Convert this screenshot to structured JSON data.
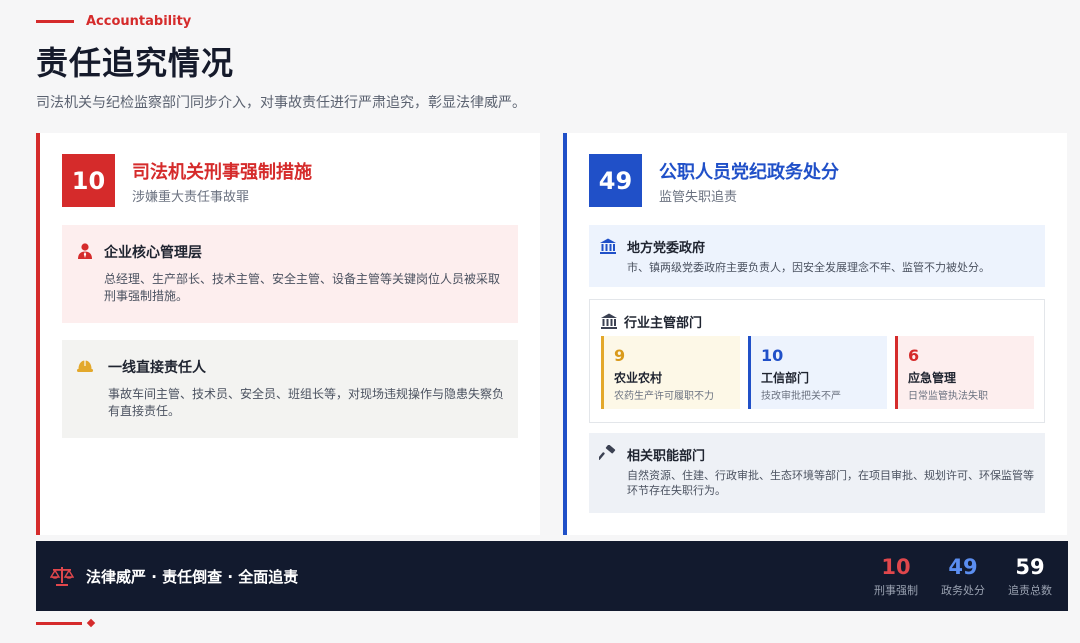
{
  "header": {
    "eyebrow": "Accountability",
    "title": "责任追究情况",
    "subtitle": "司法机关与纪检监察部门同步介入，对事故责任进行严肃追究，彰显法律威严。"
  },
  "left_panel": {
    "number": "10",
    "title": "司法机关刑事强制措施",
    "subtitle": "涉嫌重大责任事故罪",
    "cards": [
      {
        "icon": "person-icon",
        "title": "企业核心管理层",
        "text": "总经理、生产部长、技术主管、安全主管、设备主管等关键岗位人员被采取刑事强制措施。"
      },
      {
        "icon": "hard-hat-icon",
        "title": "一线直接责任人",
        "text": "事故车间主管、技术员、安全员、班组长等，对现场违规操作与隐患失察负有直接责任。"
      }
    ]
  },
  "right_panel": {
    "number": "49",
    "title": "公职人员党纪政务处分",
    "subtitle": "监管失职追责",
    "local_gov": {
      "icon": "government-building-icon",
      "title": "地方党委政府",
      "text": "市、镇两级党委政府主要负责人，因安全发展理念不牢、监管不力被处分。"
    },
    "industry": {
      "icon": "government-building-icon",
      "title": "行业主管部门",
      "items": [
        {
          "number": "9",
          "name": "农业农村",
          "desc": "农药生产许可履职不力"
        },
        {
          "number": "10",
          "name": "工信部门",
          "desc": "技改审批把关不严"
        },
        {
          "number": "6",
          "name": "应急管理",
          "desc": "日常监管执法失职"
        }
      ]
    },
    "related": {
      "icon": "gavel-icon",
      "title": "相关职能部门",
      "text": "自然资源、住建、行政审批、生态环境等部门，在项目审批、规划许可、环保监管等环节存在失职行为。"
    }
  },
  "footer": {
    "icon": "scales-icon",
    "slogan": "法律威严 · 责任倒查 · 全面追责",
    "stats": [
      {
        "number": "10",
        "label": "刑事强制",
        "color": "#e0474c"
      },
      {
        "number": "49",
        "label": "政务处分",
        "color": "#5b8ef0"
      },
      {
        "number": "59",
        "label": "追责总数",
        "color": "#ffffff"
      }
    ]
  },
  "colors": {
    "red": "#d52b2b",
    "blue": "#2050c8",
    "amber": "#e3a82b",
    "navy": "#121a2e"
  }
}
